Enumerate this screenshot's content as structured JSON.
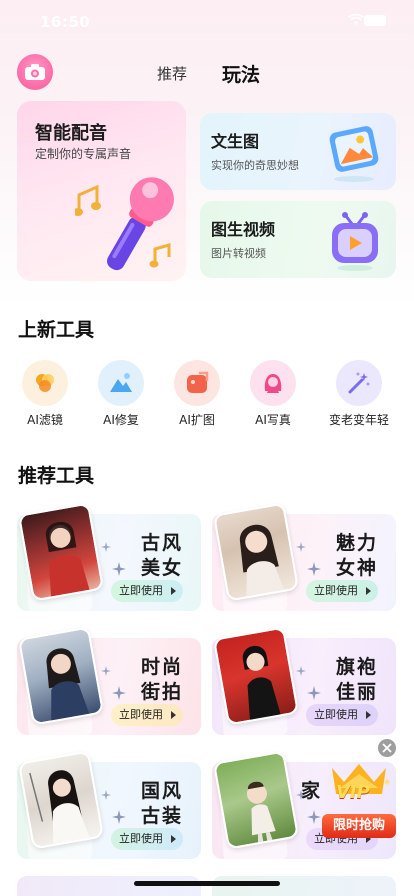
{
  "status": {
    "time": "16:50"
  },
  "nav": {
    "tabs": [
      "推荐",
      "玩法"
    ],
    "active": "玩法"
  },
  "features": {
    "voice": {
      "title": "智能配音",
      "subtitle": "定制你的专属声音"
    },
    "text_to_image": {
      "title": "文生图",
      "subtitle": "实现你的奇思妙想"
    },
    "image_to_video": {
      "title": "图生视频",
      "subtitle": "图片转视频"
    }
  },
  "sections": {
    "new_tools": "上新工具",
    "recommended": "推荐工具"
  },
  "new_tools": [
    {
      "label": "AI滤镜",
      "icon": "filter-icon",
      "color": "#f5a623"
    },
    {
      "label": "AI修复",
      "icon": "landscape-icon",
      "color": "#4aa8f0"
    },
    {
      "label": "AI扩图",
      "icon": "expand-image-icon",
      "color": "#f2644a"
    },
    {
      "label": "AI写真",
      "icon": "portrait-icon",
      "color": "#f04a8c"
    },
    {
      "label": "变老变年轻",
      "icon": "magic-wand-icon",
      "color": "#7a6cf2"
    }
  ],
  "recommended": [
    {
      "line1": "古风",
      "line2": "美女",
      "button": "立即使用"
    },
    {
      "line1": "魅力",
      "line2": "女神",
      "button": "立即使用"
    },
    {
      "line1": "时尚",
      "line2": "街拍",
      "button": "立即使用"
    },
    {
      "line1": "旗袍",
      "line2": "佳丽",
      "button": "立即使用"
    },
    {
      "line1": "国风",
      "line2": "古装",
      "button": "立即使用"
    },
    {
      "line1": "家",
      "line2": "",
      "button": "立即使用"
    }
  ],
  "promo": {
    "badge": "VIP",
    "label": "限时抢购"
  },
  "colors": {
    "accent_pink": "#ff6fa9",
    "promo_red": "#e02b17"
  }
}
